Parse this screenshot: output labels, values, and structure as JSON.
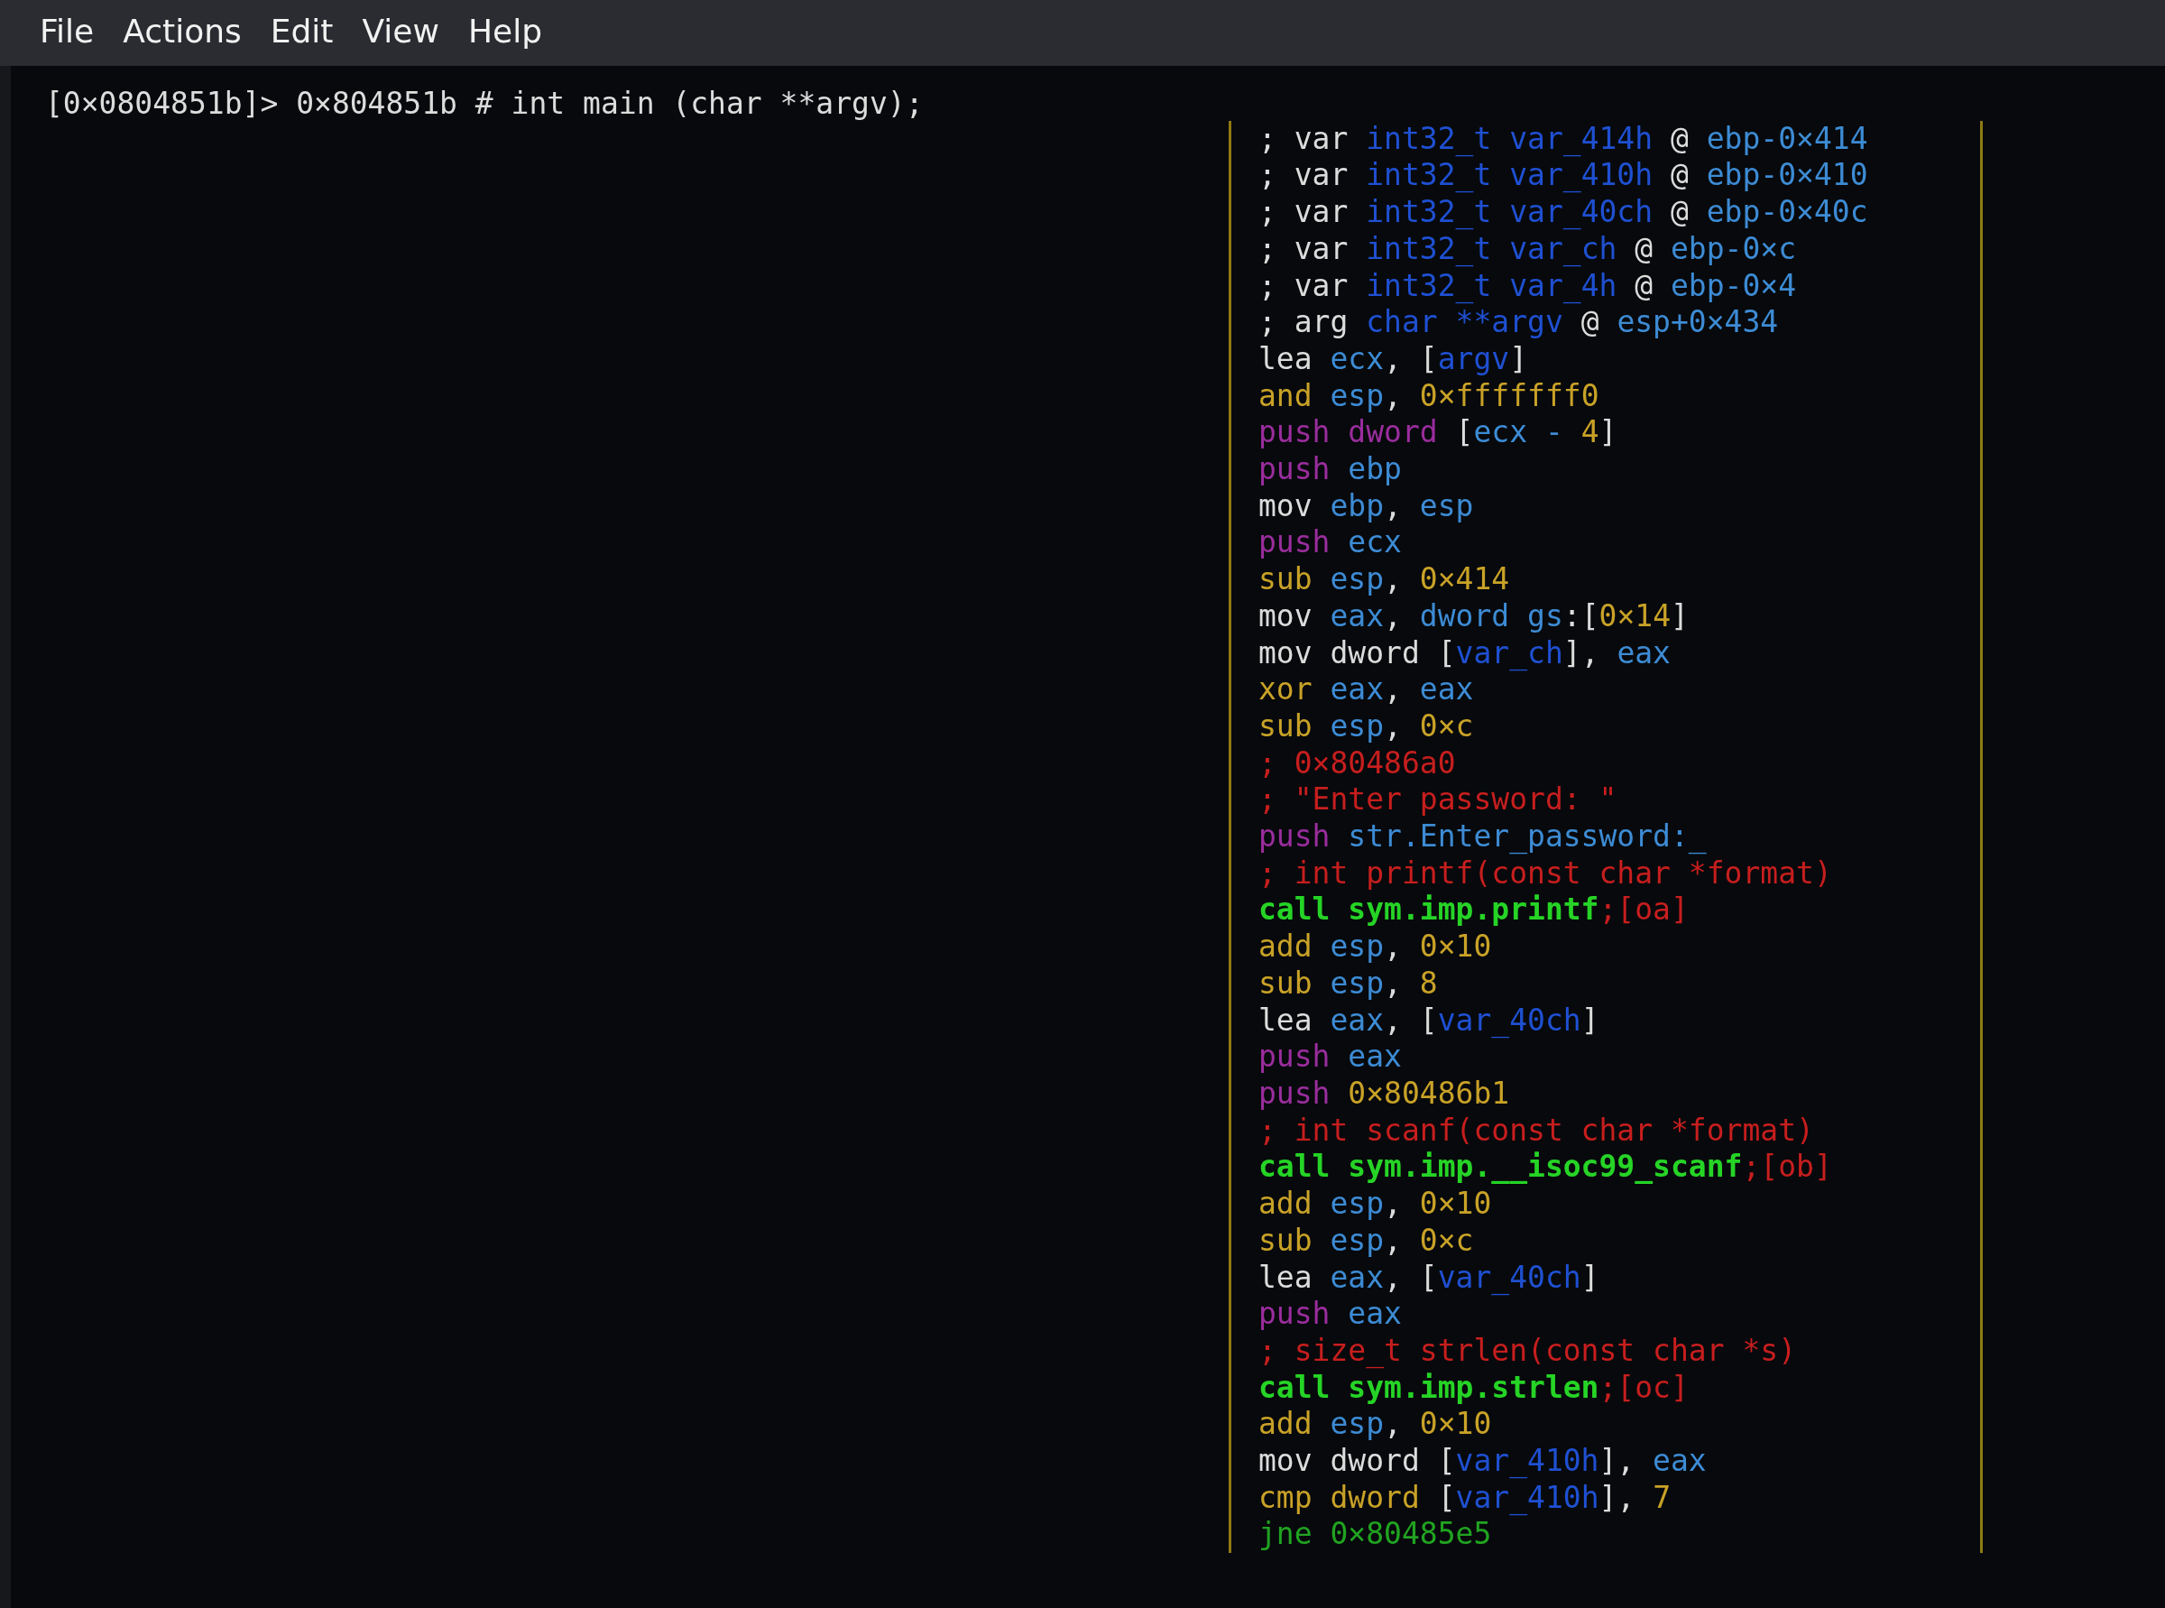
{
  "menu": [
    "File",
    "Actions",
    "Edit",
    "View",
    "Help"
  ],
  "terminal": {
    "prompt_line": "[0×0804851b]> 0×804851b # int main (char **argv);",
    "graph_node": {
      "lines": [
        [
          {
            "text": "; var ",
            "kind": "text"
          },
          {
            "text": "int32_t var_414h",
            "kind": "type"
          },
          {
            "text": " @ ",
            "kind": "text"
          },
          {
            "text": "ebp-0×414",
            "kind": "reg"
          }
        ],
        [
          {
            "text": "; var ",
            "kind": "text"
          },
          {
            "text": "int32_t var_410h",
            "kind": "type"
          },
          {
            "text": " @ ",
            "kind": "text"
          },
          {
            "text": "ebp-0×410",
            "kind": "reg"
          }
        ],
        [
          {
            "text": "; var ",
            "kind": "text"
          },
          {
            "text": "int32_t var_40ch",
            "kind": "type"
          },
          {
            "text": " @ ",
            "kind": "text"
          },
          {
            "text": "ebp-0×40c",
            "kind": "reg"
          }
        ],
        [
          {
            "text": "; var ",
            "kind": "text"
          },
          {
            "text": "int32_t var_ch",
            "kind": "type"
          },
          {
            "text": " @ ",
            "kind": "text"
          },
          {
            "text": "ebp-0×c",
            "kind": "reg"
          }
        ],
        [
          {
            "text": "; var ",
            "kind": "text"
          },
          {
            "text": "int32_t var_4h",
            "kind": "type"
          },
          {
            "text": " @ ",
            "kind": "text"
          },
          {
            "text": "ebp-0×4",
            "kind": "reg"
          }
        ],
        [
          {
            "text": "; arg ",
            "kind": "text"
          },
          {
            "text": "char **argv",
            "kind": "type"
          },
          {
            "text": " @ ",
            "kind": "text"
          },
          {
            "text": "esp+0×434",
            "kind": "reg"
          }
        ],
        [
          {
            "text": "lea ",
            "kind": "text"
          },
          {
            "text": "ecx",
            "kind": "reg"
          },
          {
            "text": ", [",
            "kind": "text"
          },
          {
            "text": "argv",
            "kind": "type"
          },
          {
            "text": "]",
            "kind": "text"
          }
        ],
        [
          {
            "text": "and ",
            "kind": "op"
          },
          {
            "text": "esp",
            "kind": "reg"
          },
          {
            "text": ", ",
            "kind": "text"
          },
          {
            "text": "0×fffffff0",
            "kind": "num"
          }
        ],
        [
          {
            "text": "push dword",
            "kind": "push"
          },
          {
            "text": " [",
            "kind": "text"
          },
          {
            "text": "ecx - ",
            "kind": "reg"
          },
          {
            "text": "4",
            "kind": "num"
          },
          {
            "text": "]",
            "kind": "text"
          }
        ],
        [
          {
            "text": "push ",
            "kind": "push"
          },
          {
            "text": "ebp",
            "kind": "reg"
          }
        ],
        [
          {
            "text": "mov ",
            "kind": "text"
          },
          {
            "text": "ebp",
            "kind": "reg"
          },
          {
            "text": ", ",
            "kind": "text"
          },
          {
            "text": "esp",
            "kind": "reg"
          }
        ],
        [
          {
            "text": "push ",
            "kind": "push"
          },
          {
            "text": "ecx",
            "kind": "reg"
          }
        ],
        [
          {
            "text": "sub ",
            "kind": "op"
          },
          {
            "text": "esp",
            "kind": "reg"
          },
          {
            "text": ", ",
            "kind": "text"
          },
          {
            "text": "0×414",
            "kind": "num"
          }
        ],
        [
          {
            "text": "mov ",
            "kind": "text"
          },
          {
            "text": "eax",
            "kind": "reg"
          },
          {
            "text": ", ",
            "kind": "text"
          },
          {
            "text": "dword gs",
            "kind": "reg"
          },
          {
            "text": ":[",
            "kind": "text"
          },
          {
            "text": "0×14",
            "kind": "num"
          },
          {
            "text": "]",
            "kind": "text"
          }
        ],
        [
          {
            "text": "mov dword [",
            "kind": "text"
          },
          {
            "text": "var_ch",
            "kind": "type"
          },
          {
            "text": "], ",
            "kind": "text"
          },
          {
            "text": "eax",
            "kind": "reg"
          }
        ],
        [
          {
            "text": "xor ",
            "kind": "op"
          },
          {
            "text": "eax",
            "kind": "reg"
          },
          {
            "text": ", ",
            "kind": "text"
          },
          {
            "text": "eax",
            "kind": "reg"
          }
        ],
        [
          {
            "text": "sub ",
            "kind": "op"
          },
          {
            "text": "esp",
            "kind": "reg"
          },
          {
            "text": ", ",
            "kind": "text"
          },
          {
            "text": "0×c",
            "kind": "num"
          }
        ],
        [
          {
            "text": "; 0×80486a0",
            "kind": "comment"
          }
        ],
        [
          {
            "text": "; \"Enter password: \"",
            "kind": "comment"
          }
        ],
        [
          {
            "text": "push ",
            "kind": "push"
          },
          {
            "text": "str.Enter_password:_",
            "kind": "reg"
          }
        ],
        [
          {
            "text": "; int printf(const char *format)",
            "kind": "comment"
          }
        ],
        [
          {
            "text": "call sym.imp.printf",
            "kind": "call"
          },
          {
            "text": ";[oa]",
            "kind": "comment"
          }
        ],
        [
          {
            "text": "add ",
            "kind": "op"
          },
          {
            "text": "esp",
            "kind": "reg"
          },
          {
            "text": ", ",
            "kind": "text"
          },
          {
            "text": "0×10",
            "kind": "num"
          }
        ],
        [
          {
            "text": "sub ",
            "kind": "op"
          },
          {
            "text": "esp",
            "kind": "reg"
          },
          {
            "text": ", ",
            "kind": "text"
          },
          {
            "text": "8",
            "kind": "num"
          }
        ],
        [
          {
            "text": "lea ",
            "kind": "text"
          },
          {
            "text": "eax",
            "kind": "reg"
          },
          {
            "text": ", [",
            "kind": "text"
          },
          {
            "text": "var_40ch",
            "kind": "type"
          },
          {
            "text": "]",
            "kind": "text"
          }
        ],
        [
          {
            "text": "push ",
            "kind": "push"
          },
          {
            "text": "eax",
            "kind": "reg"
          }
        ],
        [
          {
            "text": "push ",
            "kind": "push"
          },
          {
            "text": "0×80486b1",
            "kind": "num"
          }
        ],
        [
          {
            "text": "; int scanf(const char *format)",
            "kind": "comment"
          }
        ],
        [
          {
            "text": "call sym.imp.__isoc99_scanf",
            "kind": "call"
          },
          {
            "text": ";[ob]",
            "kind": "comment"
          }
        ],
        [
          {
            "text": "add ",
            "kind": "op"
          },
          {
            "text": "esp",
            "kind": "reg"
          },
          {
            "text": ", ",
            "kind": "text"
          },
          {
            "text": "0×10",
            "kind": "num"
          }
        ],
        [
          {
            "text": "sub ",
            "kind": "op"
          },
          {
            "text": "esp",
            "kind": "reg"
          },
          {
            "text": ", ",
            "kind": "text"
          },
          {
            "text": "0×c",
            "kind": "num"
          }
        ],
        [
          {
            "text": "lea ",
            "kind": "text"
          },
          {
            "text": "eax",
            "kind": "reg"
          },
          {
            "text": ", [",
            "kind": "text"
          },
          {
            "text": "var_40ch",
            "kind": "type"
          },
          {
            "text": "]",
            "kind": "text"
          }
        ],
        [
          {
            "text": "push ",
            "kind": "push"
          },
          {
            "text": "eax",
            "kind": "reg"
          }
        ],
        [
          {
            "text": "; size_t strlen(const char *s)",
            "kind": "comment"
          }
        ],
        [
          {
            "text": "call sym.imp.strlen",
            "kind": "call"
          },
          {
            "text": ";[oc]",
            "kind": "comment"
          }
        ],
        [
          {
            "text": "add ",
            "kind": "op"
          },
          {
            "text": "esp",
            "kind": "reg"
          },
          {
            "text": ", ",
            "kind": "text"
          },
          {
            "text": "0×10",
            "kind": "num"
          }
        ],
        [
          {
            "text": "mov dword [",
            "kind": "text"
          },
          {
            "text": "var_410h",
            "kind": "type"
          },
          {
            "text": "], ",
            "kind": "text"
          },
          {
            "text": "eax",
            "kind": "reg"
          }
        ],
        [
          {
            "text": "cmp dword",
            "kind": "op"
          },
          {
            "text": " [",
            "kind": "text"
          },
          {
            "text": "var_410h",
            "kind": "type"
          },
          {
            "text": "], ",
            "kind": "text"
          },
          {
            "text": "7",
            "kind": "num"
          }
        ],
        [
          {
            "text": "jne 0×80485e5",
            "kind": "jump"
          }
        ]
      ]
    }
  }
}
